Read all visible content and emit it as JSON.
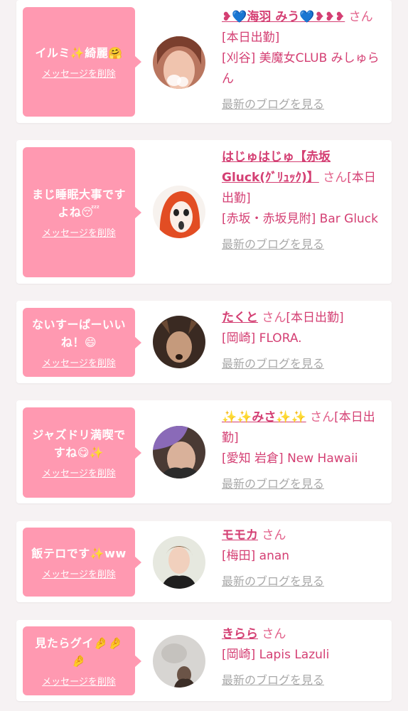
{
  "colors": {
    "page_bg": "#f6f2f3",
    "card_bg": "#ffffff",
    "bubble_bg": "#ff99b1",
    "accent": "#d43f73",
    "muted": "#a9a9a9"
  },
  "cards": [
    {
      "message": "イルミ✨綺麗🤗",
      "delete_label": "メッセージを削除",
      "name": "❥💙海羽 みう💙❥❥❥",
      "san": " さん",
      "status": "[本日出勤]",
      "shop": "[刈谷] 美魔女CLUB みしゅらん",
      "blog_label": "最新のブログを見る",
      "avatar_icon": "profile-photo-icon"
    },
    {
      "message": "まじ睡眠大事ですよね😴",
      "delete_label": "メッセージを削除",
      "name": "はじゅはじゅ【赤坂Gluck(ｸﾞﾘｭｯｸ)】",
      "san": " さん",
      "status": "[本日出勤]",
      "shop": "[赤坂・赤坂見附] Bar Gluck",
      "blog_label": "最新のブログを見る",
      "avatar_icon": "cartoon-avatar-icon"
    },
    {
      "message": "ないすーぱーいいね！😄",
      "delete_label": "メッセージを削除",
      "name": "たくと",
      "san": " さん",
      "status": "[本日出勤]",
      "shop": "[岡崎] FLORA.",
      "blog_label": "最新のブログを見る",
      "avatar_icon": "profile-photo-icon"
    },
    {
      "message": "ジャズドリ満喫ですね😋✨",
      "delete_label": "メッセージを削除",
      "name": "✨✨みさ✨✨",
      "san": " さん",
      "status": "[本日出勤]",
      "shop": "[愛知 岩倉] New Hawaii",
      "blog_label": "最新のブログを見る",
      "avatar_icon": "profile-photo-icon"
    },
    {
      "message": "飯テロです✨ww",
      "delete_label": "メッセージを削除",
      "name": "モモカ",
      "san": " さん",
      "status": "",
      "shop": "[梅田] anan",
      "blog_label": "最新のブログを見る",
      "avatar_icon": "profile-photo-icon"
    },
    {
      "message": "見たらグイ🤌🤌🤌",
      "delete_label": "メッセージを削除",
      "name": "きらら",
      "san": " さん",
      "status": "",
      "shop": "[岡崎] Lapis Lazuli",
      "blog_label": "最新のブログを見る",
      "avatar_icon": "profile-photo-icon"
    }
  ]
}
